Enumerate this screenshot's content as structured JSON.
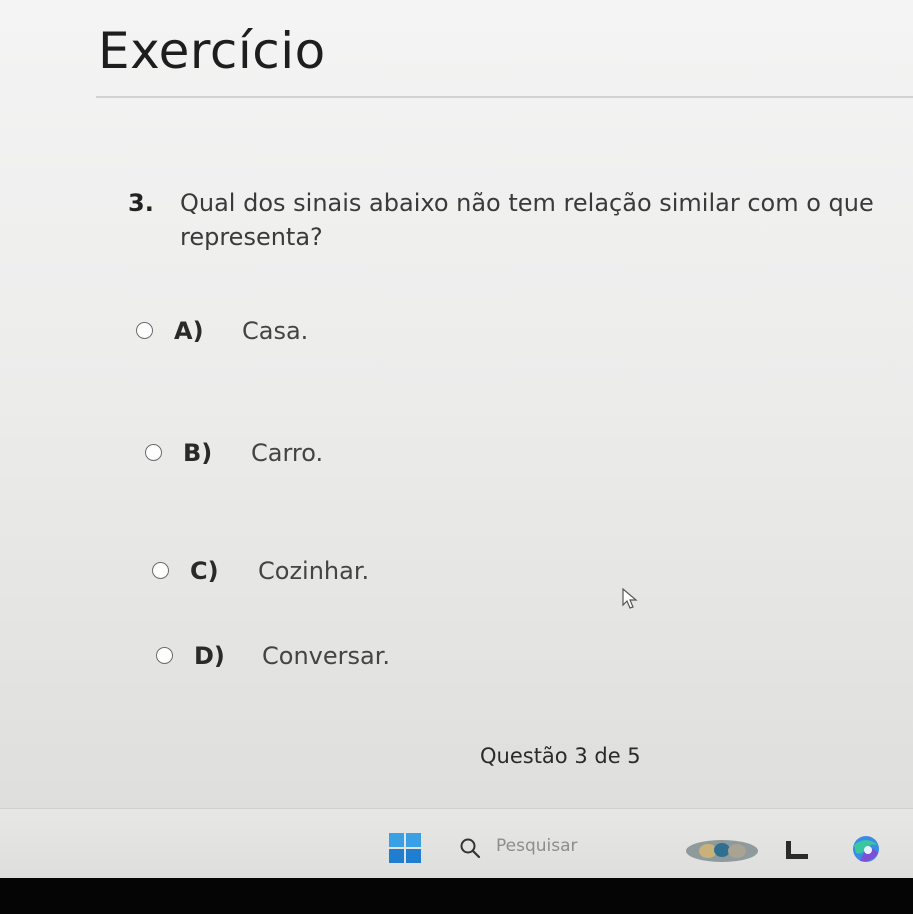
{
  "page": {
    "title": "Exercício"
  },
  "question": {
    "number": "3.",
    "text": "Qual dos sinais abaixo não tem relação similar com o que representa?"
  },
  "options": [
    {
      "letter": "A)",
      "text": "Casa."
    },
    {
      "letter": "B)",
      "text": "Carro."
    },
    {
      "letter": "C)",
      "text": "Cozinhar."
    },
    {
      "letter": "D)",
      "text": "Conversar."
    }
  ],
  "progress": {
    "label": "Questão 3 de 5"
  },
  "taskbar": {
    "search_placeholder": "Pesquisar",
    "icons": [
      "windows-start-icon",
      "search-icon",
      "widget-icon",
      "app-icon",
      "browser-icon"
    ]
  },
  "colors": {
    "accent_blue": "#1f7ed0",
    "text_dark": "#1e1e1e",
    "background": "#ececeb"
  }
}
